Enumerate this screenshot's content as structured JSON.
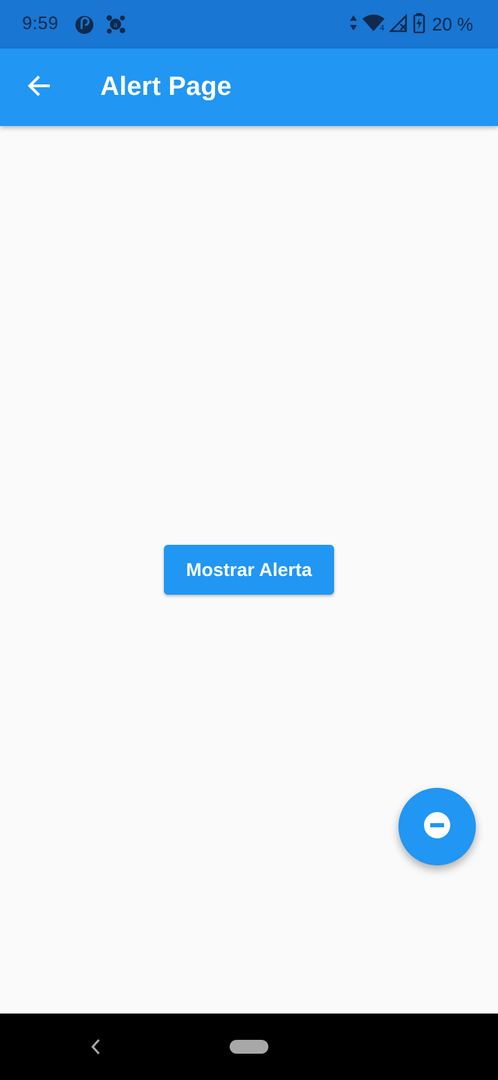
{
  "status_bar": {
    "time": "9:59",
    "battery_text": "20 %",
    "icons": [
      "pocket-casts-icon",
      "avast-icon",
      "data-arrows-icon",
      "wifi-icon",
      "signal-icon",
      "battery-charging-icon"
    ]
  },
  "app_bar": {
    "title": "Alert Page",
    "back_icon": "arrow-back-icon"
  },
  "main": {
    "button_label": "Mostrar Alerta"
  },
  "fab": {
    "icon": "remove-circle-icon"
  },
  "nav_bar": {
    "icons": [
      "nav-back-icon",
      "nav-home-pill"
    ]
  },
  "colors": {
    "status_bar": "#1976d2",
    "app_bar": "#2196f3",
    "background": "#fafafa",
    "button": "#2196f3",
    "nav_bar": "#000000"
  }
}
